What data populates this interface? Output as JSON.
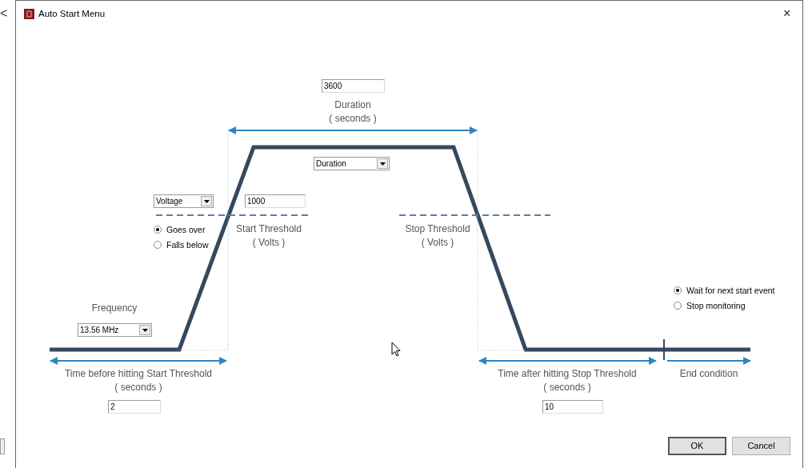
{
  "background": {
    "chevron": "<"
  },
  "window": {
    "title": "Auto Start Menu",
    "close": "×"
  },
  "duration": {
    "value": "3600",
    "label": "Duration",
    "unit": "( seconds )",
    "mode": "Duration"
  },
  "start": {
    "measure": "Voltage",
    "value": "1000",
    "label": "Start Threshold",
    "unit": "(    Volts    )",
    "direction": [
      {
        "label": "Goes over",
        "selected": true
      },
      {
        "label": "Falls below",
        "selected": false
      }
    ]
  },
  "stop": {
    "label": "Stop Threshold",
    "unit": "(    Volts    )"
  },
  "frequency": {
    "label": "Frequency",
    "value": "13.56 MHz"
  },
  "before": {
    "label": "Time before hitting Start Threshold",
    "unit": "( seconds )",
    "value": "2"
  },
  "after": {
    "label": "Time after hitting Stop Threshold",
    "unit": "( seconds )",
    "value": "10"
  },
  "end": {
    "label": "End condition",
    "options": [
      {
        "label": "Wait for next start event",
        "selected": true
      },
      {
        "label": "Stop monitoring",
        "selected": false
      }
    ]
  },
  "buttons": [
    {
      "label": "OK",
      "kind": "default"
    },
    {
      "label": "Cancel",
      "kind": "normal"
    }
  ]
}
